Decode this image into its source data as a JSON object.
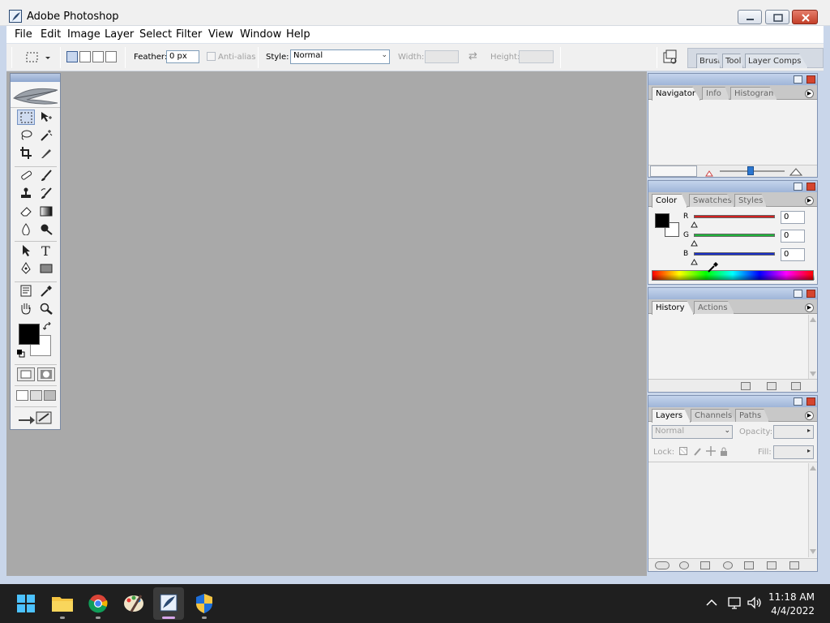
{
  "window": {
    "title": "Adobe Photoshop"
  },
  "menubar": [
    "File",
    "Edit",
    "Image",
    "Layer",
    "Select",
    "Filter",
    "View",
    "Window",
    "Help"
  ],
  "options_bar": {
    "feather_label": "Feather:",
    "feather_value": "0 px",
    "anti_alias_label": "Anti-alias",
    "style_label": "Style:",
    "style_value": "Normal",
    "width_label": "Width:",
    "height_label": "Height:",
    "palette_well_tabs": [
      "Brush",
      "Tool",
      "Layer Comps"
    ]
  },
  "toolbox": {
    "tools": [
      "rectangular-marquee-tool",
      "move-tool",
      "lasso-tool",
      "magic-wand-tool",
      "crop-tool",
      "slice-tool",
      "healing-brush-tool",
      "brush-tool",
      "clone-stamp-tool",
      "history-brush-tool",
      "eraser-tool",
      "gradient-tool",
      "blur-tool",
      "dodge-tool",
      "path-selection-tool",
      "type-tool",
      "pen-tool",
      "rectangle-tool",
      "notes-tool",
      "eyedropper-tool",
      "hand-tool",
      "zoom-tool"
    ],
    "type_tool_glyph": "T",
    "foreground_color": "#000000",
    "background_color": "#ffffff"
  },
  "navigator_palette": {
    "tabs": [
      "Navigator",
      "Info",
      "Histogram"
    ]
  },
  "color_palette": {
    "tabs": [
      "Color",
      "Swatches",
      "Styles"
    ],
    "channels": [
      {
        "label": "R",
        "value": "0",
        "color": "#d32020"
      },
      {
        "label": "G",
        "value": "0",
        "color": "#1fb53a"
      },
      {
        "label": "B",
        "value": "0",
        "color": "#1a2fc7"
      }
    ]
  },
  "history_palette": {
    "tabs": [
      "History",
      "Actions"
    ]
  },
  "layers_palette": {
    "tabs": [
      "Layers",
      "Channels",
      "Paths"
    ],
    "blend_mode": "Normal",
    "opacity_label": "Opacity:",
    "lock_label": "Lock:",
    "fill_label": "Fill:"
  },
  "taskbar": {
    "apps": [
      "start-button",
      "file-explorer",
      "chrome",
      "paint",
      "photoshop",
      "security"
    ],
    "time": "11:18 AM",
    "date": "4/4/2022"
  }
}
